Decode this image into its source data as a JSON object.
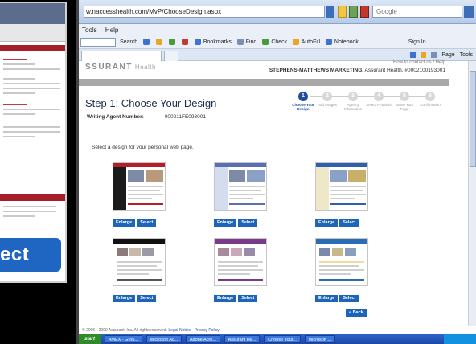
{
  "left_window": {
    "button_label": "ect"
  },
  "browser": {
    "url": "w.naccesshealth.com/MvP/ChooseDesign.aspx",
    "search_placeholder": "Google",
    "menu": [
      "Tools",
      "Help"
    ],
    "google_toolbar": [
      "Search",
      "Bookmarks",
      "Find",
      "Check",
      "AutoFill",
      "Notebook",
      "Sign In"
    ],
    "command_bar": [
      "Page",
      "Tools"
    ]
  },
  "page": {
    "logo": "SSURANT",
    "logo_suffix": "Health",
    "header_link": "How to contact us / Help",
    "agency_name": "STEPHENS-MATTHEWS MARKETING,",
    "agency_rest": "Assurant Health, #0002100193001",
    "step_title": "Step 1: Choose Your Design",
    "agent_label": "Writing Agent Number:",
    "agent_number": "000211FE093001",
    "intro": "Select a design for your personal web page.",
    "steps": [
      {
        "num": "1",
        "label": "Choose Your Design",
        "active": true
      },
      {
        "num": "2",
        "label": "Add Images",
        "active": false
      },
      {
        "num": "3",
        "label": "Agency Information",
        "active": false
      },
      {
        "num": "4",
        "label": "Select Products",
        "active": false
      },
      {
        "num": "5",
        "label": "Name Your Page",
        "active": false
      },
      {
        "num": "6",
        "label": "Confirmation",
        "active": false
      }
    ],
    "designs": [
      {
        "enlarge": "Enlarge",
        "select": "Select",
        "accent": "#b3202a",
        "side": "#1b1b1b"
      },
      {
        "enlarge": "Enlarge",
        "select": "Select",
        "accent": "#5a6fb2",
        "side": "#d6dcef"
      },
      {
        "enlarge": "Enlarge",
        "select": "Select",
        "accent": "#2f5fae",
        "side": "#efe8c8"
      },
      {
        "enlarge": "Enlarge",
        "select": "Select",
        "accent": "#111111",
        "side": "#f1f1f1"
      },
      {
        "enlarge": "Enlarge",
        "select": "Select",
        "accent": "#7a3a8a",
        "side": "#f4eef6"
      },
      {
        "enlarge": "Enlarge",
        "select": "Select",
        "accent": "#2c6cb5",
        "side": "#f8e9b8"
      }
    ],
    "back_button": "« Back",
    "footer_text": "© 2006 - 2009 Assurant, Inc. All rights reserved.",
    "footer_links": "Legal Notice · Privacy Policy"
  },
  "taskbar": {
    "start": "start",
    "tasks": [
      "AMEX - Grou...",
      "Microsoft Ac...",
      "Adobe Acro...",
      "Assurant He...",
      "Choose Your...",
      "Microsoft ..."
    ]
  }
}
